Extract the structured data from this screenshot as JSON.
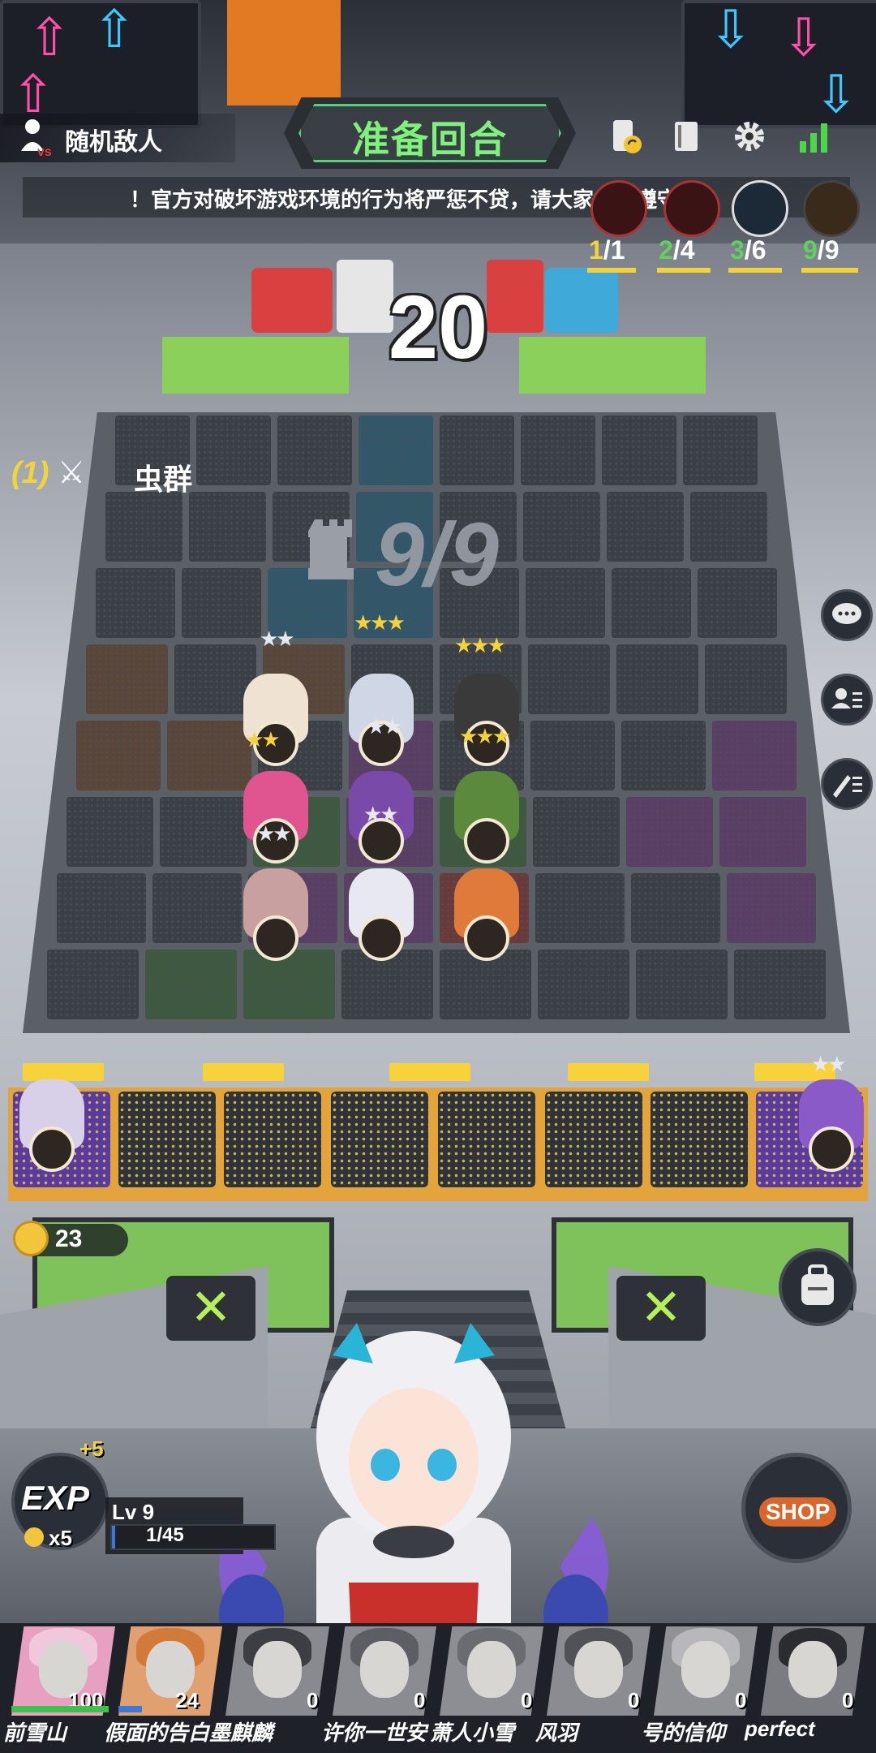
{
  "top_bar": {
    "enemy_label": "随机敌人",
    "round_title": "准备回合",
    "marquee": "！官方对破坏游戏环境的行为将严惩不贷，请大家自觉遵守"
  },
  "synergies": [
    {
      "count": "1",
      "max": "/1",
      "color": "#f4d23c"
    },
    {
      "count": "2",
      "max": "/4",
      "color": "#5ed25a"
    },
    {
      "count": "3",
      "max": "/6",
      "color": "#5ed25a"
    },
    {
      "count": "9",
      "max": "/9",
      "color": "#5ed25a"
    }
  ],
  "countdown": "20",
  "opponent": {
    "index": "(1)",
    "name": "虫群"
  },
  "board": {
    "unit_count": "9/9"
  },
  "gold": "23",
  "exp": {
    "label": "EXP",
    "plus": "+5",
    "cost": "x5",
    "level": "Lv 9",
    "progress_text": "1/45",
    "progress": 0.022
  },
  "shop": {
    "label": "SHOP"
  },
  "players": [
    {
      "score": "100",
      "name": "前雪山",
      "hp": 1.0,
      "color": "#3fbf4b"
    },
    {
      "score": "24",
      "name": "假面的告白墨麒麟",
      "hp": 0.24,
      "color": "#3c78d8"
    },
    {
      "score": "0",
      "name": "",
      "hp": 0
    },
    {
      "score": "0",
      "name": "许你一世安",
      "hp": 0
    },
    {
      "score": "0",
      "name": "萧人小雪",
      "hp": 0
    },
    {
      "score": "0",
      "name": "风羽",
      "hp": 0
    },
    {
      "score": "0",
      "name": "号的信仰",
      "hp": 0
    },
    {
      "score": "0",
      "name": "perfect",
      "hp": 0
    }
  ],
  "colors": {
    "accent_green": "#7ef27a",
    "gold": "#f2c53a",
    "bench_frame": "#e3a53b"
  }
}
